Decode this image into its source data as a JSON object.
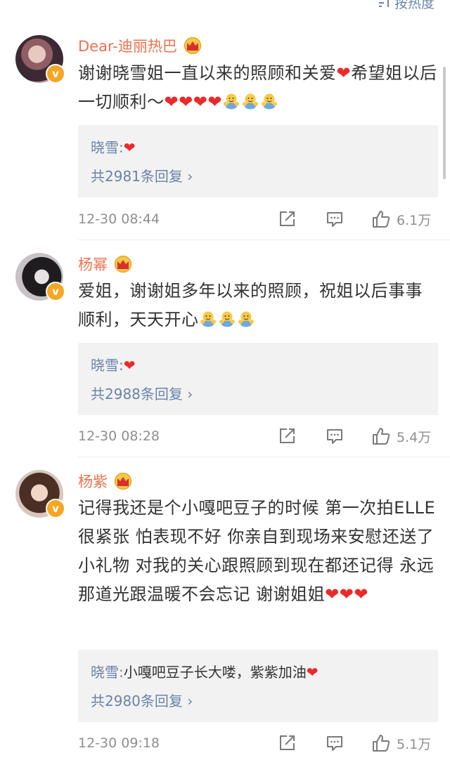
{
  "sort": {
    "label": "按热度",
    "icon": "sort-icon"
  },
  "comments": [
    {
      "author": "Dear-迪丽热巴",
      "avatar_icon": "avatar-photo",
      "verified_badge": "v",
      "text_before": "谢谢晓雪姐一直以来的照顾和关爱",
      "text_after": "希望姐以后一切顺利～",
      "reply": {
        "name": "晓雪:",
        "text": ""
      },
      "more_replies": "共2981条回复 ›",
      "time": "12-30 08:44",
      "likes": "6.1万"
    },
    {
      "author": "杨幂",
      "avatar_icon": "avatar-photo",
      "verified_badge": "v",
      "text": "爱姐，谢谢姐多年以来的照顾，祝姐以后事事顺利，天天开心",
      "reply": {
        "name": "晓雪:",
        "text": ""
      },
      "more_replies": "共2988条回复 ›",
      "time": "12-30 08:28",
      "likes": "5.4万"
    },
    {
      "author": "杨紫",
      "avatar_icon": "avatar-photo",
      "verified_badge": "v",
      "text": "记得我还是个小嘎吧豆子的时候 第一次拍ELLE 很紧张 怕表现不好 你亲自到现场来安慰还送了小礼物 对我的关心跟照顾到现在都还记得 永远那道光跟温暖不会忘记 谢谢姐姐",
      "reply": {
        "name": "晓雪:",
        "text": "小嘎吧豆子长大喽，紫紫加油"
      },
      "more_replies": "共2980条回复 ›",
      "time": "12-30 09:18",
      "likes": "5.1万"
    }
  ],
  "colors": {
    "author": "#eb7350",
    "link": "#6a83a6",
    "heart": "#ea2a2a",
    "badge": "#f5a623",
    "meta": "#8f8f8f"
  }
}
